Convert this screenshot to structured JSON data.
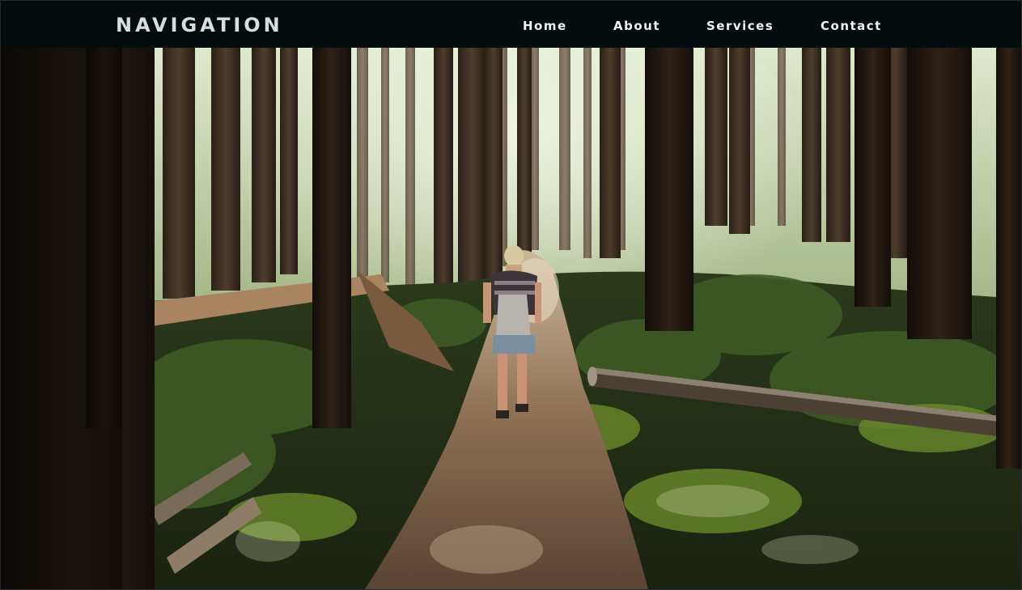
{
  "navbar": {
    "brand": "NAVIGATION",
    "links": [
      {
        "label": "Home"
      },
      {
        "label": "About"
      },
      {
        "label": "Services"
      },
      {
        "label": "Contact"
      }
    ],
    "background": "#040c0d",
    "text_color": "#f2f2f2"
  },
  "hero": {
    "image_subject": "forest-trail-hiker-photo",
    "palette": {
      "canopy_light": "#e9f1d6",
      "foliage": "#2f4a22",
      "moss": "#6f8f2c",
      "trunk_dark": "#1c140e",
      "trail": "#6b5240"
    }
  }
}
